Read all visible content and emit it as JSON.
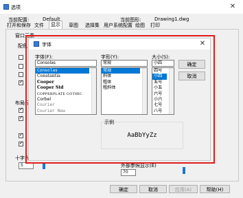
{
  "outer": {
    "title": "选项",
    "current_profile_label": "当前配置:",
    "current_profile_value": "Default",
    "current_drawing_label": "当前图形:",
    "current_drawing_value": "Drawing1.dwg",
    "tabs": [
      "打开和保存",
      "文件",
      "显示",
      "草图",
      "选择集",
      "用户系统配置",
      "绘图",
      "打印"
    ],
    "active_tab": "显示",
    "frag_window": "窗口元素",
    "frag_config": "配色",
    "frag_layout": "布局元",
    "frag_crosshair": "十字光标",
    "frag_display": "外部参照显示(E)",
    "crosshair_value": "5",
    "xref_value": "70",
    "buttons": {
      "ok": "确定",
      "cancel": "取消",
      "apply": "应用(A)",
      "help": "帮助(H)"
    }
  },
  "dialog": {
    "title": "字体",
    "font_label": "字体(F):",
    "font_value": "Consolas",
    "fonts": [
      "Consolas",
      "Constantia",
      "Cooper",
      "Cooper Std",
      "COPPERPLATE GOTHIC",
      "Corbel",
      "Courier",
      "Courier New"
    ],
    "font_selected_index": 0,
    "style_label": "字形(Y):",
    "style_value": "常规",
    "styles": [
      "常规",
      "斜体",
      "粗体",
      "粗斜体"
    ],
    "style_selected_index": 0,
    "size_label": "大小(S):",
    "size_value": "小四",
    "sizes": [
      "四号",
      "小四",
      "五号",
      "小五",
      "六号",
      "小六",
      "七号",
      "八号"
    ],
    "size_selected_index": 1,
    "ok_label": "确定",
    "cancel_label": "取消",
    "sample_label": "示例",
    "sample_text": "AaBbYyZz"
  },
  "colors": {
    "highlight": "#0078d7",
    "annotation_frame": "#e21b1b",
    "slider": "#1e78d0"
  }
}
